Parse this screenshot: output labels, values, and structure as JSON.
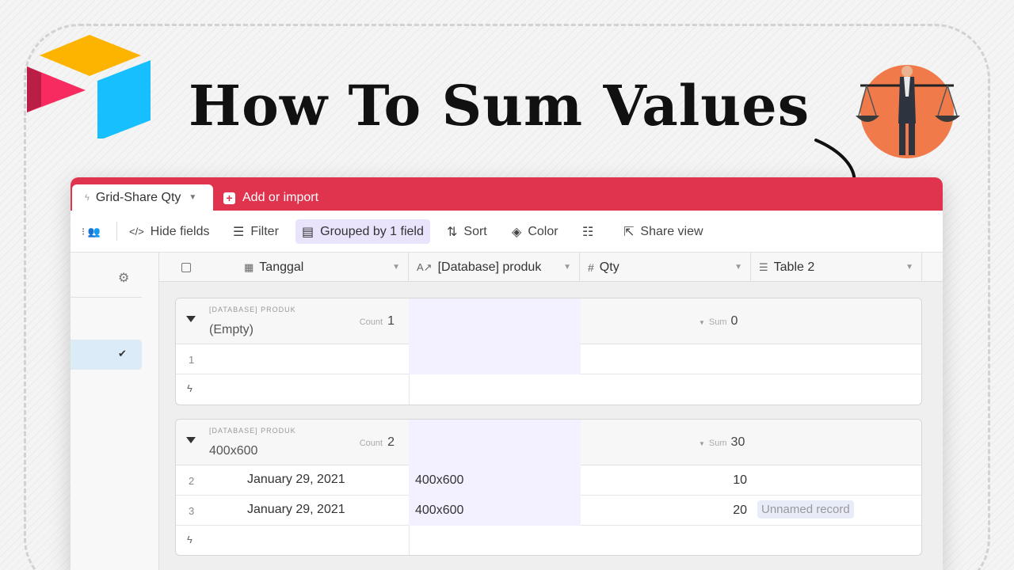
{
  "headline": "How To Sum Values",
  "brand_colors": {
    "logo_yellow": "#fcb400",
    "logo_blue": "#18bfff",
    "logo_red": "#f82b60",
    "tab_bar": "#e0344e",
    "badge": "#f07a4a"
  },
  "tabs": {
    "active": "Grid-Share Qty",
    "add": "Add or import"
  },
  "toolbar": {
    "hide_fields": "Hide fields",
    "filter": "Filter",
    "grouped": "Grouped by 1 field",
    "sort": "Sort",
    "color": "Color",
    "share": "Share view"
  },
  "columns": {
    "tanggal": "Tanggal",
    "produk": "[Database] produk",
    "qty": "Qty",
    "table2": "Table 2"
  },
  "groups": [
    {
      "field": "[DATABASE] PRODUK",
      "value": "(Empty)",
      "count_label": "Count",
      "count": "1",
      "sum_label": "Sum",
      "sum": "0",
      "rows": [
        {
          "num": "1",
          "date": "",
          "produk": "",
          "qty": "",
          "table2": ""
        }
      ]
    },
    {
      "field": "[DATABASE] PRODUK",
      "value": "400x600",
      "count_label": "Count",
      "count": "2",
      "sum_label": "Sum",
      "sum": "30",
      "rows": [
        {
          "num": "2",
          "date": "January 29, 2021",
          "produk": "400x600",
          "qty": "10",
          "table2": ""
        },
        {
          "num": "3",
          "date": "January 29, 2021",
          "produk": "400x600",
          "qty": "20",
          "table2": "Unnamed record"
        }
      ]
    }
  ]
}
